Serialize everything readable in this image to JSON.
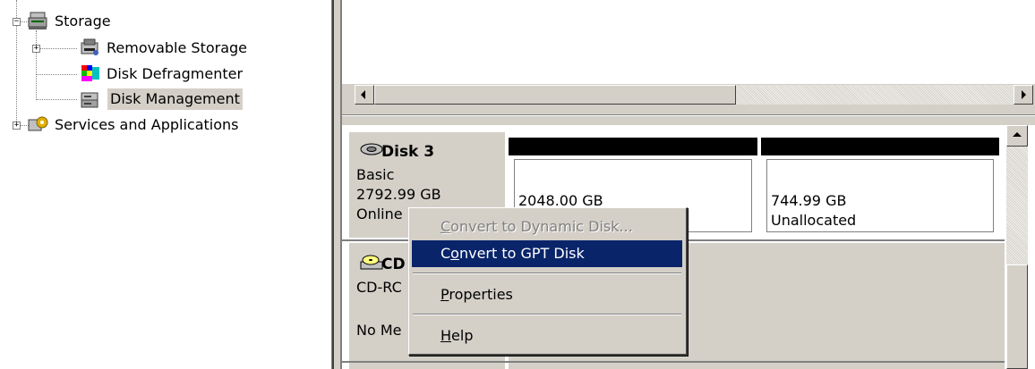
{
  "tree": {
    "items": [
      {
        "label": "Storage",
        "expander": "−",
        "icon": "storage-icon"
      },
      {
        "label": "Removable Storage",
        "expander": "+",
        "icon": "removable-storage-icon"
      },
      {
        "label": "Disk Defragmenter",
        "icon": "disk-defragmenter-icon"
      },
      {
        "label": "Disk Management",
        "icon": "disk-management-icon",
        "selected": true
      },
      {
        "label": "Services and Applications",
        "expander": "+",
        "icon": "services-applications-icon"
      }
    ]
  },
  "disks": {
    "disk3": {
      "title": "Disk 3",
      "type": "Basic",
      "size": "2792.99 GB",
      "status": "Online",
      "partitions": [
        {
          "size": "2048.00 GB",
          "status": ""
        },
        {
          "size": "744.99 GB",
          "status": "Unallocated"
        }
      ]
    },
    "cdrom": {
      "title_visible": "CD",
      "type_visible": "CD-RC",
      "status_visible": "No Me"
    }
  },
  "context_menu": {
    "items": [
      {
        "pre": "",
        "accel": "C",
        "post": "onvert to Dynamic Disk...",
        "state": "disabled"
      },
      {
        "pre": "C",
        "accel": "o",
        "post": "nvert to GPT Disk",
        "state": "highlighted"
      },
      {
        "pre": "",
        "accel": "P",
        "post": "roperties",
        "state": "normal"
      },
      {
        "pre": "",
        "accel": "H",
        "post": "elp",
        "state": "normal"
      }
    ]
  },
  "colors": {
    "window_face": "#d4d0c8",
    "selection": "#0a246a",
    "partition_header": "#000000",
    "disabled_text": "#808080"
  }
}
